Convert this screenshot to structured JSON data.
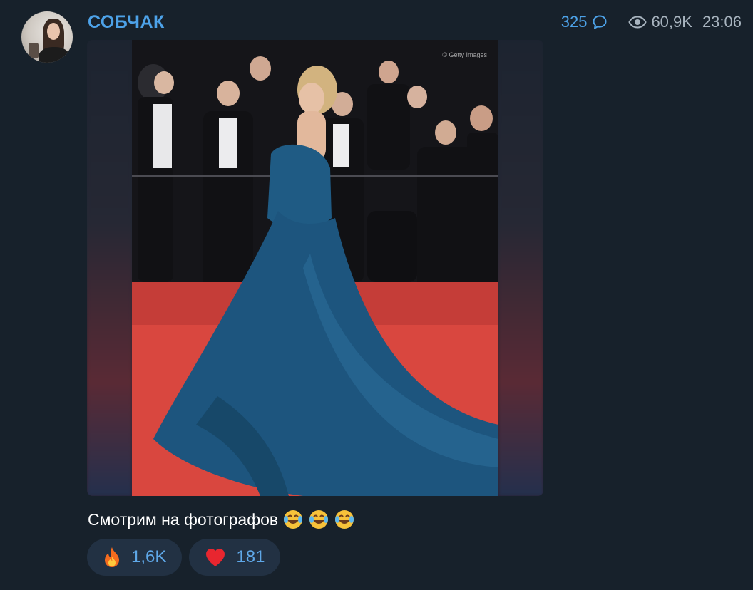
{
  "post": {
    "channel": "СОБЧАК",
    "comments_count": "325",
    "views": "60,9K",
    "time": "23:06",
    "watermark": "© Getty Images",
    "caption": "Смотрим на фотографов",
    "caption_emoji": [
      "face-with-tears-of-joy-icon",
      "face-with-tears-of-joy-icon",
      "face-with-tears-of-joy-icon"
    ],
    "reactions": [
      {
        "icon": "fire-icon",
        "count": "1,6K"
      },
      {
        "icon": "red-heart-icon",
        "count": "181"
      }
    ]
  },
  "colors": {
    "background": "#17212b",
    "accent": "#4da2e8",
    "reaction_bg": "#223143",
    "meta": "#a8b4bf"
  }
}
